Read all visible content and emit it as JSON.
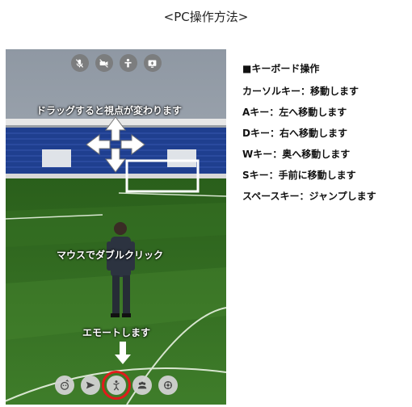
{
  "page": {
    "title": "<PC操作方法>"
  },
  "viewport": {
    "top_icons": [
      "mic-muted-icon",
      "camera-muted-icon",
      "avatar-icon",
      "screen-share-icon"
    ],
    "bottom_icons": [
      "emoji-icon",
      "send-icon",
      "emote-icon",
      "people-icon",
      "settings-icon"
    ],
    "drag_hint": "ドラッグすると視点が変わります",
    "double_click_hint": "マウスでダブルクリック",
    "emote_hint": "エモートします"
  },
  "instructions": {
    "heading": "■キーボード操作",
    "lines": [
      "カーソルキー：移動します",
      "Aキー：左へ移動します",
      "Dキー：右へ移動します",
      "Wキー：奥へ移動します",
      "Sキー：手前に移動します",
      "スペースキー：ジャンプします"
    ]
  },
  "colors": {
    "highlight": "#e11b1b",
    "pitch": "#2f6b1f",
    "stands": "#1f3f8f"
  }
}
